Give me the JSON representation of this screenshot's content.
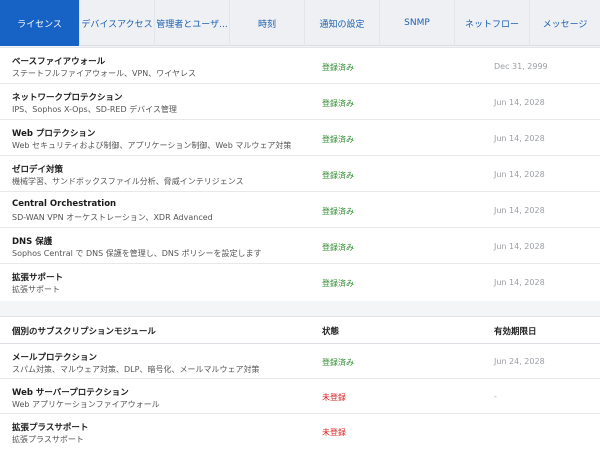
{
  "tabs": [
    {
      "label": "ライセンス",
      "active": true
    },
    {
      "label": "デバイスアクセス",
      "active": false
    },
    {
      "label": "管理者とユーザ...",
      "active": false
    },
    {
      "label": "時刻",
      "active": false
    },
    {
      "label": "通知の設定",
      "active": false
    },
    {
      "label": "SNMP",
      "active": false
    },
    {
      "label": "ネットフロー",
      "active": false
    },
    {
      "label": "メッセージ",
      "active": false
    }
  ],
  "licenses": [
    {
      "name": "ベースファイアウォール",
      "desc": "ステートフルファイアウォール、VPN、ワイヤレス",
      "status": "登録済み",
      "expiry": "Dec 31, 2999"
    },
    {
      "name": "ネットワークプロテクション",
      "desc": "IPS、Sophos X-Ops、SD-RED デバイス管理",
      "status": "登録済み",
      "expiry": "Jun 14, 2028"
    },
    {
      "name": "Web プロテクション",
      "desc": "Web セキュリティおよび制御、アプリケーション制御、Web マルウェア対策",
      "status": "登録済み",
      "expiry": "Jun 14, 2028"
    },
    {
      "name": "ゼロデイ対策",
      "desc": "機械学習、サンドボックスファイル分析、脅威インテリジェンス",
      "status": "登録済み",
      "expiry": "Jun 14, 2028"
    },
    {
      "name": "Central Orchestration",
      "desc": "SD-WAN VPN オーケストレーション、XDR Advanced",
      "status": "登録済み",
      "expiry": "Jun 14, 2028"
    },
    {
      "name": "DNS 保護",
      "desc": "Sophos Central で DNS 保護を管理し、DNS ポリシーを設定します",
      "status": "登録済み",
      "expiry": "Jun 14, 2028"
    },
    {
      "name": "拡張サポート",
      "desc": "拡張サポート",
      "status": "登録済み",
      "expiry": "Jun 14, 2028"
    }
  ],
  "module_table": {
    "col_module": "個別のサブスクリプションモジュール",
    "col_status": "状態",
    "col_expiry": "有効期限日"
  },
  "modules": [
    {
      "name": "メールプロテクション",
      "desc": "スパム対策、マルウェア対策、DLP、暗号化、メールマルウェア対策",
      "status": "登録済み",
      "status_type": "ok",
      "expiry": "Jun 24, 2028"
    },
    {
      "name": "Web サーバープロテクション",
      "desc": "Web アプリケーションファイアウォール",
      "status": "未登録",
      "status_type": "ng",
      "expiry": "-"
    },
    {
      "name": "拡張プラスサポート",
      "desc": "拡張プラスサポート",
      "status": "未登録",
      "status_type": "ng",
      "expiry": ""
    }
  ],
  "colors": {
    "accent": "#1662c5",
    "ok": "#2a8a2a",
    "ng": "#d42020"
  }
}
